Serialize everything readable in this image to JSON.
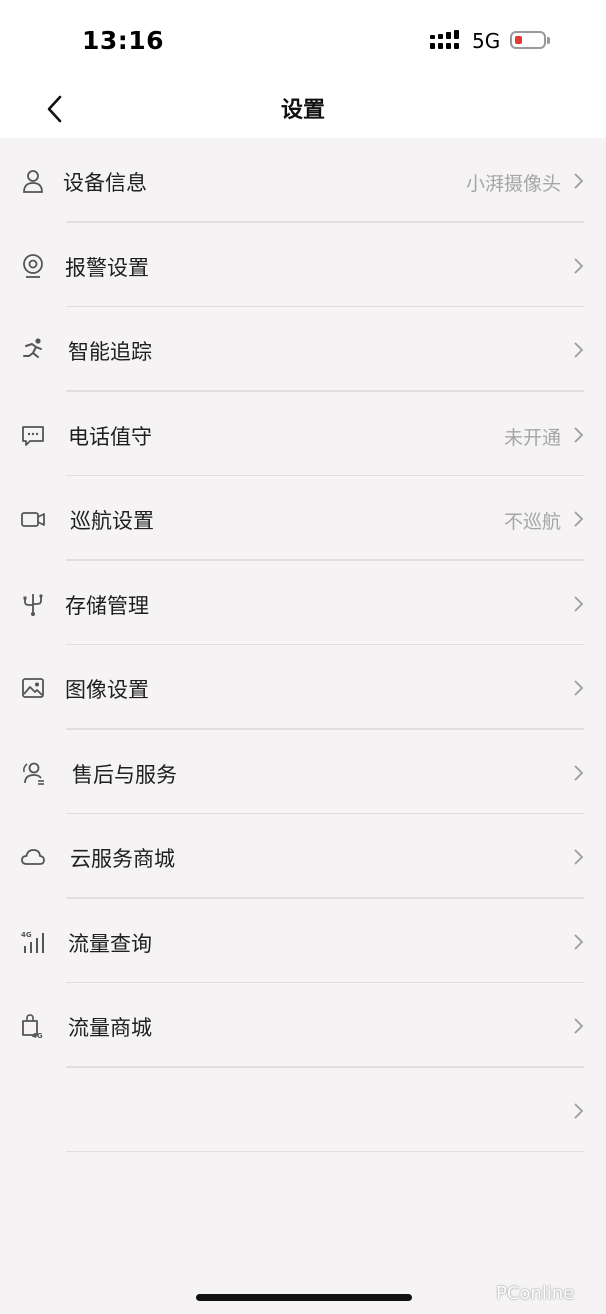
{
  "status": {
    "time": "13:16",
    "network": "5G"
  },
  "nav": {
    "title": "设置",
    "back_icon": "chevron-left-icon"
  },
  "items": [
    {
      "label": "设备信息",
      "value": "小湃摄像头",
      "icon": "person-icon"
    },
    {
      "label": "报警设置",
      "value": "",
      "icon": "webcam-icon"
    },
    {
      "label": "智能追踪",
      "value": "",
      "icon": "running-person-icon"
    },
    {
      "label": "电话值守",
      "value": "未开通",
      "icon": "message-icon"
    },
    {
      "label": "巡航设置",
      "value": "不巡航",
      "icon": "video-camera-icon"
    },
    {
      "label": "存储管理",
      "value": "",
      "icon": "usb-icon"
    },
    {
      "label": "图像设置",
      "value": "",
      "icon": "image-icon"
    },
    {
      "label": "售后与服务",
      "value": "",
      "icon": "service-person-icon"
    },
    {
      "label": "云服务商城",
      "value": "",
      "icon": "cloud-icon"
    },
    {
      "label": "流量查询",
      "value": "",
      "icon": "4g-signal-icon"
    },
    {
      "label": "流量商城",
      "value": "",
      "icon": "4g-shopping-bag-icon"
    },
    {
      "label": "",
      "value": "",
      "icon": ""
    }
  ],
  "watermark": "PConline",
  "colors": {
    "accent_battery": "#e53935",
    "secondary_text": "#a6a6a6",
    "background": "#f5f3f4"
  }
}
